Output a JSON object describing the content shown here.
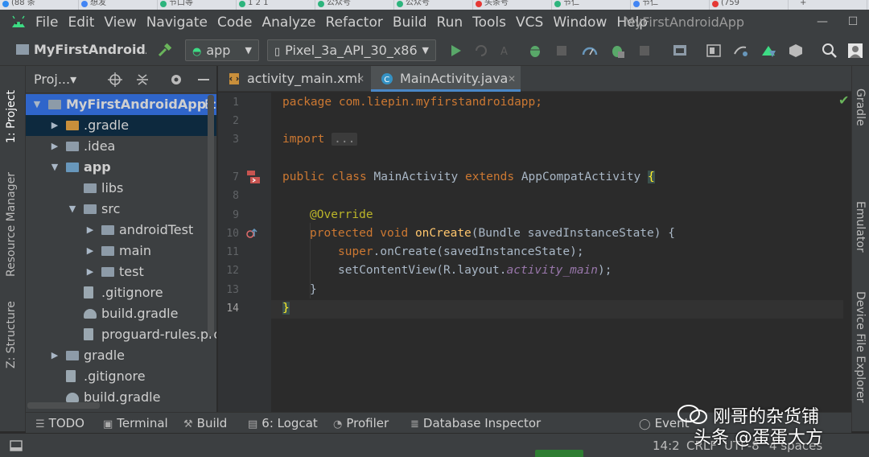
{
  "browser_tabs": [
    {
      "label": "(88 条",
      "color": "#2f8cf1"
    },
    {
      "label": "想发",
      "color": "#4285f4"
    },
    {
      "label": "节口等",
      "color": "#2db47d"
    },
    {
      "label": "1 2 1",
      "color": "#2db47d"
    },
    {
      "label": "公众号",
      "color": "#2db47d"
    },
    {
      "label": "公众号",
      "color": "#2db47d"
    },
    {
      "label": "头条号",
      "color": "#e53935"
    },
    {
      "label": "节仁",
      "color": "#2db47d"
    },
    {
      "label": "节仁",
      "color": "#4285f4"
    },
    {
      "label": "(759",
      "color": "#e53935"
    },
    {
      "label": "+",
      "color": ""
    }
  ],
  "menu": [
    "File",
    "Edit",
    "View",
    "Navigate",
    "Code",
    "Analyze",
    "Refactor",
    "Build",
    "Run",
    "Tools",
    "VCS",
    "Window",
    "Help"
  ],
  "window": {
    "title": "MyFirstAndroidApp",
    "minimize": "—",
    "maximize": "☐",
    "close": "✕"
  },
  "toolbar": {
    "project_name": "MyFirstAndroidApp",
    "run_config": "app",
    "device": "Pixel_3a_API_30_x86",
    "dropdown_arrow": "▼"
  },
  "left_tabs": {
    "project": "1: Project",
    "resource_manager": "Resource Manager",
    "structure": "Z: Structure"
  },
  "right_tabs": {
    "gradle": "Gradle",
    "emulator": "Emulator",
    "device_explorer": "Device File Explorer"
  },
  "project_panel": {
    "title": "Proj...▾",
    "tree": [
      {
        "label": "MyFirstAndroidApp",
        "extra": "E:\\A",
        "depth": 0,
        "chev": "▼",
        "icon": "folder",
        "bold": true
      },
      {
        "label": ".gradle",
        "depth": 1,
        "chev": "▶",
        "icon": "folder-orange"
      },
      {
        "label": ".idea",
        "depth": 1,
        "chev": "▶",
        "icon": "folder"
      },
      {
        "label": "app",
        "depth": 1,
        "chev": "▼",
        "icon": "folder-module",
        "bold": true
      },
      {
        "label": "libs",
        "depth": 2,
        "chev": "",
        "icon": "folder"
      },
      {
        "label": "src",
        "depth": 2,
        "chev": "▼",
        "icon": "folder"
      },
      {
        "label": "androidTest",
        "depth": 3,
        "chev": "▶",
        "icon": "folder"
      },
      {
        "label": "main",
        "depth": 3,
        "chev": "▶",
        "icon": "folder"
      },
      {
        "label": "test",
        "depth": 3,
        "chev": "▶",
        "icon": "folder"
      },
      {
        "label": ".gitignore",
        "depth": 2,
        "chev": "",
        "icon": "file"
      },
      {
        "label": "build.gradle",
        "depth": 2,
        "chev": "",
        "icon": "gradle"
      },
      {
        "label": "proguard-rules.pro",
        "depth": 2,
        "chev": "",
        "icon": "file"
      },
      {
        "label": "gradle",
        "depth": 1,
        "chev": "▶",
        "icon": "folder"
      },
      {
        "label": ".gitignore",
        "depth": 1,
        "chev": "",
        "icon": "file"
      },
      {
        "label": "build.gradle",
        "depth": 1,
        "chev": "",
        "icon": "gradle"
      }
    ]
  },
  "editor": {
    "tabs": [
      {
        "label": "activity_main.xml",
        "close": "✕",
        "active": false
      },
      {
        "label": "MainActivity.java",
        "close": "✕",
        "active": true
      }
    ],
    "line_numbers": [
      "1",
      "2",
      "3",
      "7",
      "8",
      "9",
      "10",
      "11",
      "12",
      "13",
      "14"
    ],
    "code": {
      "l1": "package com.liepin.myfirstandroidapp;",
      "l3a": "import",
      "l3b": "...",
      "l7a": "public class",
      "l7b": " MainActivity ",
      "l7c": "extends",
      "l7d": " AppCompatActivity ",
      "l7e": "{",
      "l9": "@Override",
      "l10a": "protected void",
      "l10b": "onCreate",
      "l10c": "(Bundle savedInstanceState) {",
      "l11a": "super",
      "l11b": ".onCreate(savedInstanceState);",
      "l12a": "setContentView(R.layout.",
      "l12b": "activity_main",
      "l12c": ");",
      "l13": "}",
      "l14": "}"
    },
    "inspection": "✔"
  },
  "bottom_tools": [
    {
      "label": "TODO",
      "icon": "☰"
    },
    {
      "label": "Terminal",
      "icon": "▣"
    },
    {
      "label": "Build",
      "icon": "⚒"
    },
    {
      "label": "6: Logcat",
      "icon": "▤"
    },
    {
      "label": "Profiler",
      "icon": "◔"
    },
    {
      "label": "Database Inspector",
      "icon": "≣"
    },
    {
      "label": "Event",
      "icon": "◯"
    }
  ],
  "status": {
    "position": "14:2",
    "line_sep": "CRLF",
    "encoding": "UTF-8",
    "indent": "4 spaces"
  },
  "watermark": {
    "line1": "刚哥的杂货铺",
    "line2": "头条 @蛋蛋大方"
  }
}
